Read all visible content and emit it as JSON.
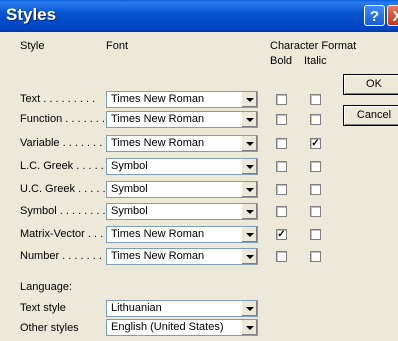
{
  "window": {
    "title": "Styles",
    "help_glyph": "?",
    "close_glyph": "X"
  },
  "headers": {
    "style": "Style",
    "font": "Font",
    "character_format": "Character Format",
    "bold": "Bold",
    "italic": "Italic"
  },
  "rows": [
    {
      "label": "Text . . . . . . . . .",
      "font": "Times New Roman",
      "bold": false,
      "italic": false
    },
    {
      "label": "Function . . . . . . .",
      "font": "Times New Roman",
      "bold": false,
      "italic": false
    },
    {
      "label": "Variable . . . . . . .",
      "font": "Times New Roman",
      "bold": false,
      "italic": true
    },
    {
      "label": "L.C. Greek . . . . .",
      "font": "Symbol",
      "bold": false,
      "italic": false
    },
    {
      "label": "U.C. Greek . . . . .",
      "font": "Symbol",
      "bold": false,
      "italic": false
    },
    {
      "label": "Symbol . . . . . . . .",
      "font": "Symbol",
      "bold": false,
      "italic": false
    },
    {
      "label": "Matrix-Vector . . . .",
      "font": "Times New Roman",
      "bold": true,
      "italic": false
    },
    {
      "label": "Number . . . . . . . .",
      "font": "Times New Roman",
      "bold": false,
      "italic": false
    }
  ],
  "language": {
    "heading": "Language:",
    "text_style_label": "Text style",
    "text_style_value": "Lithuanian",
    "other_styles_label": "Other styles",
    "other_styles_value": "English (United States)"
  },
  "buttons": {
    "ok": "OK",
    "cancel": "Cancel"
  },
  "check_glyph": "✓"
}
